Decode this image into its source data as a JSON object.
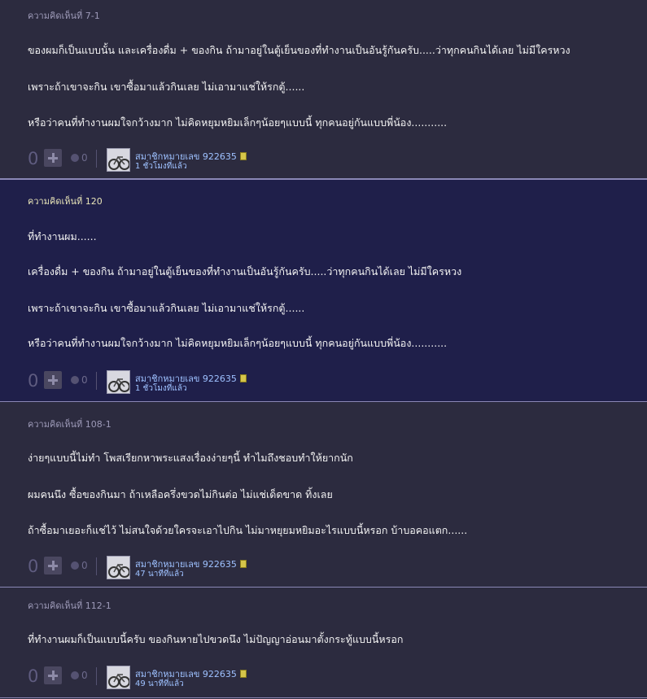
{
  "comments": [
    {
      "title": "ความคิดเห็นที่ 7-1",
      "paragraphs": [
        "ของผมก็เป็นแบบนั้น   และเครื่องดื่ม + ของกิน  ถ้ามาอยู่ในตู้เย็นของที่ทำงานเป็นอันรู้กันครับ.....ว่าทุกคนกินได้เลย  ไม่มีใครหวง",
        "เพราะถ้าเขาจะกิน  เขาซื้อมาแล้วกินเลย  ไม่เอามาแช่ให้รกตู้......",
        "หรือว่าคนที่ทำงานผมใจกว้างมาก  ไม่คิดหยุมหยิมเล็กๆน้อยๆแบบนี้   ทุกคนอยู่กันแบบพี่น้อง..........."
      ],
      "votes": "0",
      "emotions": "0",
      "member": "สมาชิกหมายเลข 922635",
      "time": "1 ชั่วโมงที่แล้ว"
    },
    {
      "title": "ความคิดเห็นที่ 120",
      "paragraphs": [
        "ที่ทำงานผม......",
        "เครื่องดื่ม + ของกิน  ถ้ามาอยู่ในตู้เย็นของที่ทำงานเป็นอันรู้กันครับ.....ว่าทุกคนกินได้เลย  ไม่มีใครหวง",
        "เพราะถ้าเขาจะกิน  เขาซื้อมาแล้วกินเลย  ไม่เอามาแช่ให้รกตู้......",
        "หรือว่าคนที่ทำงานผมใจกว้างมาก  ไม่คิดหยุมหยิมเล็กๆน้อยๆแบบนี้   ทุกคนอยู่กันแบบพี่น้อง..........."
      ],
      "votes": "0",
      "emotions": "0",
      "member": "สมาชิกหมายเลข 922635",
      "time": "1 ชั่วโมงที่แล้ว"
    },
    {
      "title": "ความคิดเห็นที่ 108-1",
      "paragraphs": [
        "ง่ายๆแบบนี้ไม่ทำ    โพสเรียกหาพระแสงเรื่องง่ายๆนี้   ทำไมถึงชอบทำให้ยากนัก",
        "ผมคนนึง  ซื้อของกินมา  ถ้าเหลือครึ่งขวดไม่กินต่อ  ไม่แช่เด็ดขาด   ทิ้งเลย",
        "ถ้าซื้อมาเยอะก็แช่ไว้  ไม่สนใจด้วยใครจะเอาไปกิน   ไม่มาหยุยมหยิมอะไรแบบนี้หรอก   บ้าบอคอแตก......"
      ],
      "votes": "0",
      "emotions": "0",
      "member": "สมาชิกหมายเลข 922635",
      "time": "47 นาทีที่แล้ว"
    },
    {
      "title": "ความคิดเห็นที่ 112-1",
      "paragraphs": [
        "ที่ทำงานผมก็เป็นแบบนี้ครับ   ของกินหายไปขวดนึง   ไม่ปัญญาอ่อนมาตั้งกระทู้แบบนี้หรอก"
      ],
      "votes": "0",
      "emotions": "0",
      "member": "สมาชิกหมายเลข 922635",
      "time": "49 นาทีที่แล้ว"
    }
  ],
  "colors": {
    "reply_bg": "#2c2b3f",
    "main_bg": "#1f1f4a",
    "link": "#9ec1ff"
  },
  "icons": [
    "plus-icon",
    "emotion-icon",
    "avatar-bicycle",
    "badge-icon"
  ]
}
